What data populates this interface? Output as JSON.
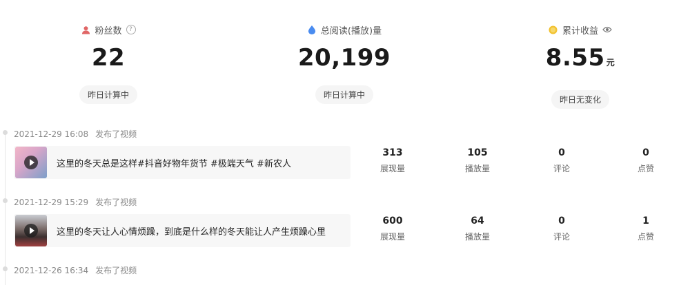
{
  "stats": [
    {
      "icon": "person-icon",
      "label": "粉丝数",
      "value": "22",
      "unit": "",
      "sub": "昨日计算中",
      "color": "#e06666"
    },
    {
      "icon": "drop-icon",
      "label": "总阅读(播放)量",
      "value": "20,199",
      "unit": "",
      "sub": "昨日计算中",
      "color": "#4a8cf0"
    },
    {
      "icon": "coin-icon",
      "label": "累计收益",
      "value": "8.55",
      "unit": "元",
      "sub": "昨日无变化",
      "color": "#f2c230"
    }
  ],
  "metric_labels": [
    "展现量",
    "播放量",
    "评论",
    "点赞"
  ],
  "entries": [
    {
      "time": "2021-12-29 16:08",
      "action": "发布了视频",
      "title": "这里的冬天总是这样#抖音好物年货节 #极端天气 #新农人",
      "metrics": [
        "313",
        "105",
        "0",
        "0"
      ]
    },
    {
      "time": "2021-12-29 15:29",
      "action": "发布了视频",
      "title": "这里的冬天让人心情烦躁，到底是什么样的冬天能让人产生烦躁心里",
      "metrics": [
        "600",
        "64",
        "0",
        "1"
      ]
    },
    {
      "time": "2021-12-26 16:34",
      "action": "发布了视频"
    }
  ]
}
